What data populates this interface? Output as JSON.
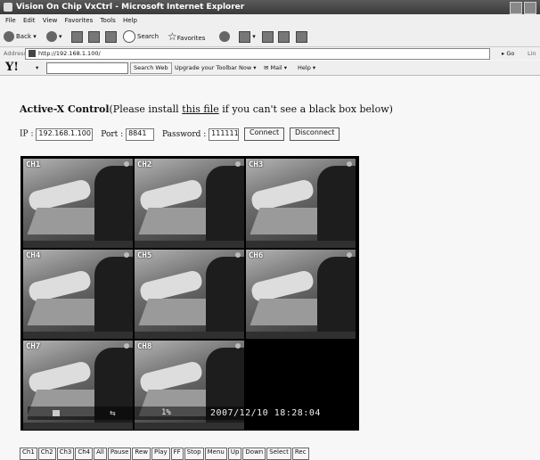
{
  "window": {
    "title": "Vision On Chip VxCtrl - Microsoft Internet Explorer"
  },
  "menu": [
    "File",
    "Edit",
    "View",
    "Favorites",
    "Tools",
    "Help"
  ],
  "toolbar": {
    "back_label": "Back",
    "search_label": "Search",
    "favorites_label": "Favorites"
  },
  "address": {
    "label": "Address",
    "url": "http://192.168.1.100/",
    "go_label": "Go",
    "links_label": "Lin"
  },
  "yahoo": {
    "logo": "Y!",
    "search_btn": "Search Web",
    "upgrade_btn": "Upgrade your Toolbar Now",
    "mail_btn": "Mail",
    "help_btn": "Help"
  },
  "page": {
    "heading_bold": "Active-X Control",
    "heading_pre": "(Please install ",
    "heading_link": "this file",
    "heading_post": " if you can't see a black box below)",
    "ip_label": "IP :",
    "ip_value": "192.168.1.100",
    "port_label": "Port :",
    "port_value": "8841",
    "password_label": "Password :",
    "password_value": "111111",
    "connect_label": "Connect",
    "disconnect_label": "Disconnect"
  },
  "viewer": {
    "channels": [
      "CH1",
      "CH2",
      "CH3",
      "CH4",
      "CH5",
      "CH6",
      "CH7",
      "CH8"
    ],
    "progress_percent": "1%",
    "timestamp": "2007/12/10 18:28:04"
  },
  "controls": [
    "Ch1",
    "Ch2",
    "Ch3",
    "Ch4",
    "All",
    "Pause",
    "Rew",
    "Play",
    "FF",
    "Stop",
    "Menu",
    "Up",
    "Down",
    "Select",
    "Rec"
  ]
}
